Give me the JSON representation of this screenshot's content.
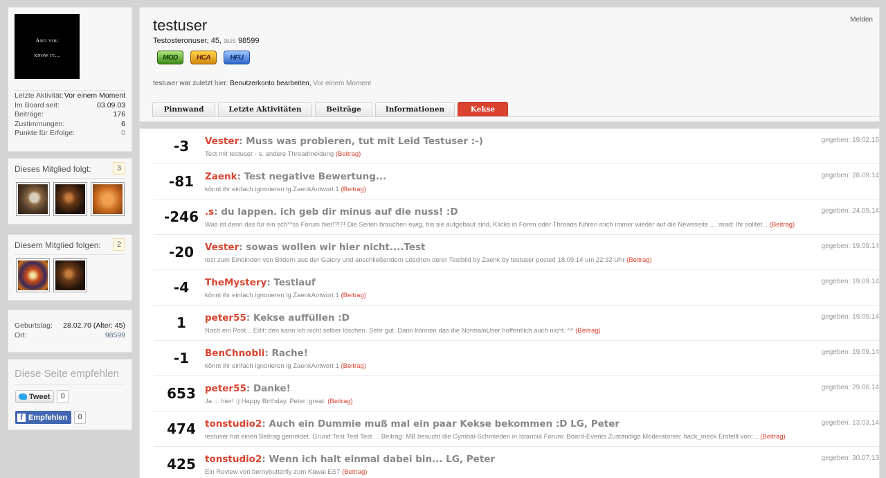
{
  "profile": {
    "avatar_line1": "And you",
    "avatar_line2": "know it...",
    "stats": [
      {
        "label": "Letzte Aktivität:",
        "value": "Vor einem Moment"
      },
      {
        "label": "Im Board seit:",
        "value": "03.09.03"
      },
      {
        "label": "Beiträge:",
        "value": "176"
      },
      {
        "label": "Zustimmungen:",
        "value": "6"
      },
      {
        "label": "Punkte für Erfolge:",
        "value": "0"
      }
    ]
  },
  "follows": {
    "label": "Dieses Mitglied folgt:",
    "count": "3"
  },
  "followers": {
    "label": "Diesem Mitglied folgen:",
    "count": "2"
  },
  "info": {
    "rows": [
      {
        "label": "Geburtstag:",
        "value": "28.02.70 (Alter: 45)"
      },
      {
        "label": "Ort:",
        "value": "98599"
      }
    ]
  },
  "share": {
    "title": "Diese Seite empfehlen",
    "tweet_label": "Tweet",
    "tweet_count": "0",
    "fb_label": "Empfehlen",
    "fb_count": "0"
  },
  "header": {
    "username": "testuser",
    "report": "Melden",
    "user_title": "Testosteronuser, 45,",
    "from_word": "aus",
    "location": "98599",
    "badges": [
      "MOD",
      "HCA",
      "HFU"
    ],
    "lastseen_prefix": "testuser war zuletzt hier:",
    "lastseen_action": "Benutzerkonto bearbeiten,",
    "lastseen_time": "Vor einem Moment"
  },
  "tabs": [
    {
      "label": "Pinnwand",
      "active": false
    },
    {
      "label": "Letzte Aktivitäten",
      "active": false
    },
    {
      "label": "Beiträge",
      "active": false
    },
    {
      "label": "Informationen",
      "active": false
    },
    {
      "label": "Kekse",
      "active": true
    }
  ],
  "kekse": [
    {
      "score": "-3",
      "author": "Vester",
      "title": "Muss was probieren, tut mit Leid Testuser :-)",
      "snippet": "Test mit testuser - s. andere Threadmeldung",
      "link": "(Beitrag)",
      "given": "gegeben: 19.02.15"
    },
    {
      "score": "-81",
      "author": "Zaenk",
      "title": "Test negative Bewertung...",
      "snippet": "könnt ihr einfach ignorieren lg ZaenkAntwort 1",
      "link": "(Beitrag)",
      "given": "gegeben: 28.09.14"
    },
    {
      "score": "-246",
      "author": ".s",
      "title": "du lappen. ich geb dir minus auf die nuss! :D",
      "snippet": "Was ist denn das für ein sch**ss Forum hier!?!?! Die Seiten brauchen ewig, bis sie aufgebaut sind, Klicks in Foren oder Threads führen mich immer wieder auf die Newsseite ... :mad: Ihr solltet...",
      "link": "(Beitrag)",
      "given": "gegeben: 24.09.14"
    },
    {
      "score": "-20",
      "author": "Vester",
      "title": "sowas wollen wir hier nicht....Test",
      "snippet": "test zum Einbinden von Bildern aus der Galery und anschließendem Löschen derer Testbild by Zaenk by testuser posted 18.09.14 um 22:32 Uhr",
      "link": "(Beitrag)",
      "given": "gegeben: 19.09.14"
    },
    {
      "score": "-4",
      "author": "TheMystery",
      "title": "Testlauf",
      "snippet": "könnt ihr einfach ignorieren lg ZaenkAntwort 1",
      "link": "(Beitrag)",
      "given": "gegeben: 19.09.14"
    },
    {
      "score": "1",
      "author": "peter55",
      "title": "Kekse auffüllen :D",
      "snippet": "Noch ein Post... Edit: den kann ich nicht selber löschen. Sehr gut. Dann können das die NormaloUser hoffentlich auch nicht. ^^",
      "link": "(Beitrag)",
      "given": "gegeben: 19.09.14"
    },
    {
      "score": "-1",
      "author": "BenChnobli",
      "title": "Rache!",
      "snippet": "könnt ihr einfach ignorieren lg ZaenkAntwort 1",
      "link": "(Beitrag)",
      "given": "gegeben: 19.09.14"
    },
    {
      "score": "653",
      "author": "peter55",
      "title": "Danke!",
      "snippet": "Ja ... hier! :) Happy Birthday, Peter :great:",
      "link": "(Beitrag)",
      "given": "gegeben: 29.06.14"
    },
    {
      "score": "474",
      "author": "tonstudio2",
      "title": "Auch ein Dummie muß mal ein paar Kekse bekommen :D LG, Peter",
      "snippet": "testuser hat einen Beitrag gemeldet. Grund:Test Test Test ... Beitrag: MB besucht die Cymbal-Schmieden in Istanbul Forum: Board-Events Zuständige Moderatoren: hack_meck Erstellt von:...",
      "link": "(Beitrag)",
      "given": "gegeben: 13.03.14"
    },
    {
      "score": "425",
      "author": "tonstudio2",
      "title": "Wenn ich halt einmal dabei bin... LG, Peter",
      "snippet": "Ein Review von bernybutterfly zum Kawai ES7",
      "link": "(Beitrag)",
      "given": "gegeben: 30.07.13"
    }
  ]
}
